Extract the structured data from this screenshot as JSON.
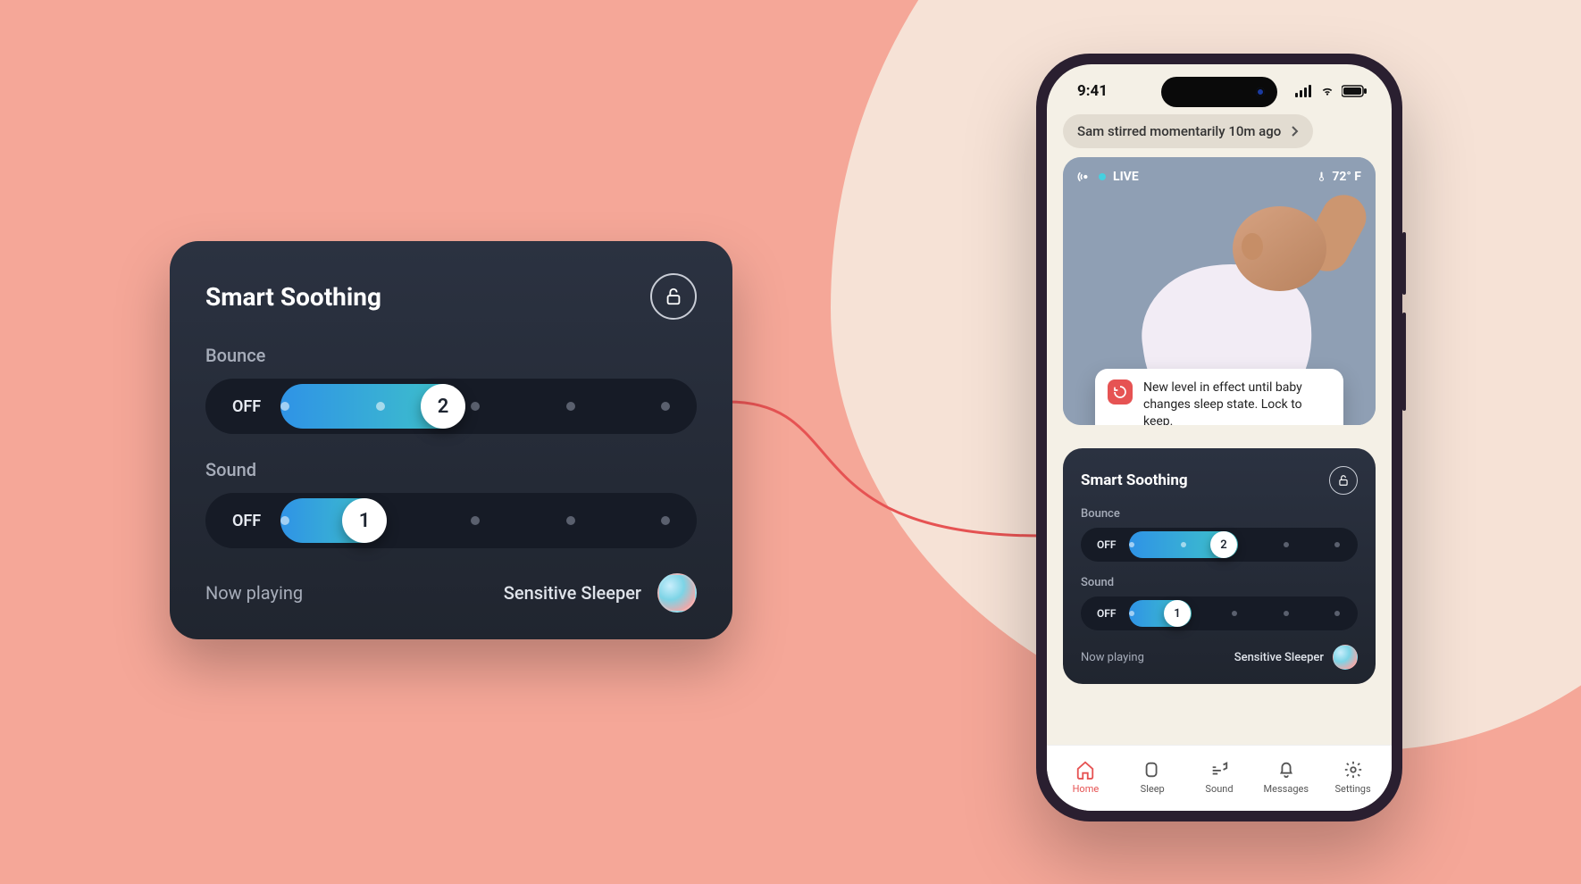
{
  "statusbar": {
    "time": "9:41"
  },
  "notification_chip": "Sam stirred momentarily 10m ago",
  "camera": {
    "live_label": "LIVE",
    "temperature": "72° F"
  },
  "toast": {
    "text": "New level in effect until baby changes sleep state. Lock to keep."
  },
  "soothing": {
    "title": "Smart Soothing",
    "bounce": {
      "label": "Bounce",
      "off_label": "OFF",
      "value": "2",
      "steps": 5,
      "level": 2
    },
    "sound": {
      "label": "Sound",
      "off_label": "OFF",
      "value": "1",
      "steps": 5,
      "level": 1
    },
    "now_playing_label": "Now playing",
    "now_playing_track": "Sensitive Sleeper"
  },
  "tabs": {
    "home": "Home",
    "sleep": "Sleep",
    "sound": "Sound",
    "messages": "Messages",
    "settings": "Settings"
  }
}
